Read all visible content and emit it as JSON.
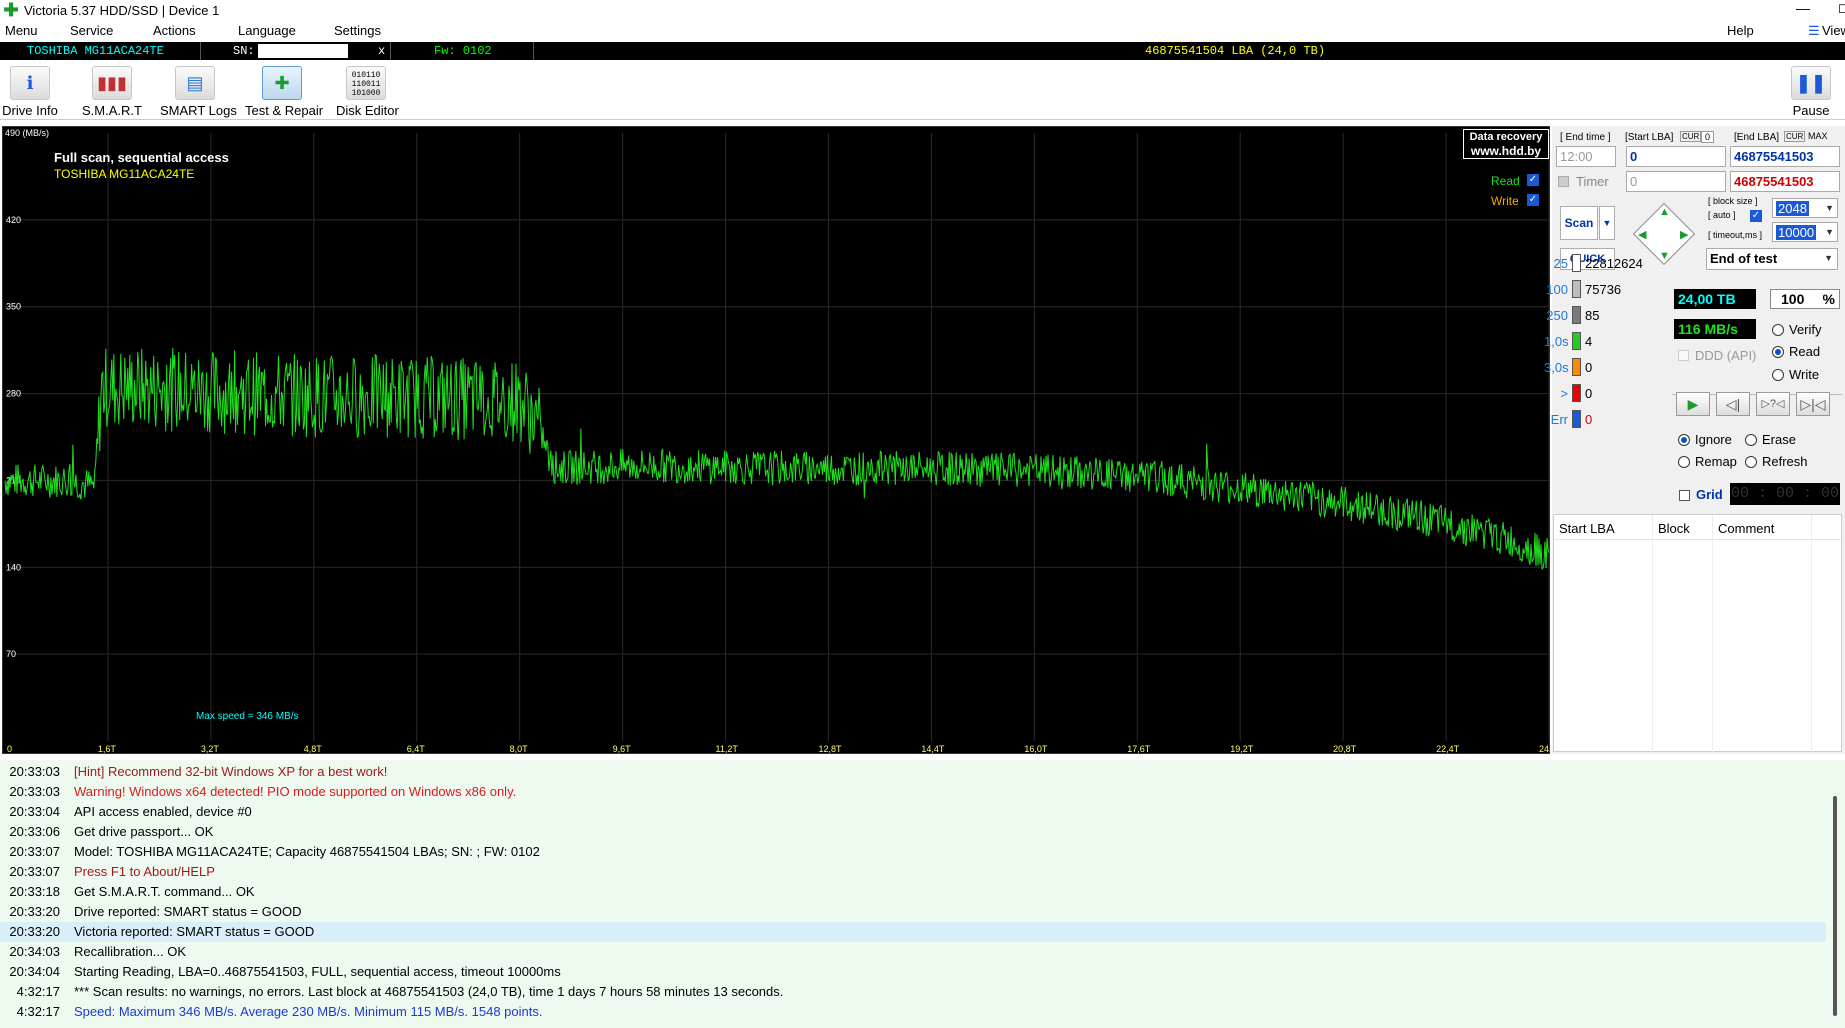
{
  "window": {
    "title": "Victoria 5.37 HDD/SSD | Device 1",
    "app_icon_color": "#1a9b2e"
  },
  "menu": {
    "items": [
      "Menu",
      "Service",
      "Actions",
      "Language",
      "Settings"
    ],
    "help": "Help",
    "view": "View"
  },
  "infobar": {
    "model": "TOSHIBA MG11ACA24TE",
    "sn_label": "SN:",
    "sn_close": "x",
    "fw": "Fw: 0102",
    "capacity": "46875541504 LBA (24,0 TB)"
  },
  "toolbar": {
    "buttons": [
      {
        "label": "Drive Info",
        "icon": "info-icon"
      },
      {
        "label": "S.M.A.R.T",
        "icon": "smart-chart-icon"
      },
      {
        "label": "SMART Logs",
        "icon": "logs-icon"
      },
      {
        "label": "Test & Repair",
        "icon": "plus-cross-icon"
      },
      {
        "label": "Disk Editor",
        "icon": "binary-icon"
      }
    ],
    "pause": "Pause"
  },
  "graph": {
    "title": "Full scan, sequential access",
    "device": "TOSHIBA MG11ACA24TE",
    "watermark1": "Data recovery",
    "watermark2": "www.hdd.by",
    "read_label": "Read",
    "write_label": "Write",
    "max_speed": "Max speed = 346 MB/s",
    "y_unit_label": "490 (MB/s)",
    "line_color": "#1fe01f"
  },
  "chart_data": {
    "type": "line",
    "title": "Full scan, sequential access",
    "xlabel": "",
    "ylabel": "(MB/s)",
    "x_ticks": [
      "0",
      "1,6T",
      "3,2T",
      "4,8T",
      "6,4T",
      "8,0T",
      "9,6T",
      "11,2T",
      "12,8T",
      "14,4T",
      "16,0T",
      "17,6T",
      "19,2T",
      "20,8T",
      "22,4T",
      "24,0T"
    ],
    "y_ticks": [
      "420",
      "350",
      "280",
      "210",
      "140",
      "70"
    ],
    "xlim": [
      0,
      24.0
    ],
    "ylim": [
      0,
      490
    ],
    "grid": true,
    "series": [
      {
        "name": "Read",
        "x": [
          0,
          1.0,
          1.4,
          1.5,
          2.0,
          3.0,
          4.0,
          5.0,
          6.0,
          7.0,
          8.0,
          8.3,
          8.5,
          10,
          12,
          14,
          16,
          17,
          18,
          19,
          20,
          21,
          22,
          23,
          24.0
        ],
        "y": [
          210,
          210,
          205,
          285,
          285,
          282,
          280,
          278,
          278,
          276,
          275,
          255,
          220,
          222,
          220,
          220,
          218,
          215,
          212,
          205,
          198,
          190,
          180,
          168,
          150
        ]
      }
    ]
  },
  "controls": {
    "end_time_label": "[ End time ]",
    "end_time": "12:00",
    "start_lba_label": "[Start LBA]",
    "cur_label": "CUR",
    "zero": "0",
    "end_lba_label": "[End LBA]",
    "max_label": "MAX",
    "start_lba": "0",
    "end_lba": "46875541503",
    "timer_label": "Timer",
    "timer_value": "0",
    "end_lba2": "46875541503",
    "scan": "Scan",
    "quick": "QUICK",
    "block_size_label": "[ block size ]",
    "auto_label": "[ auto ]",
    "timeout_label": "[ timeout,ms ]",
    "block_size": "2048",
    "timeout": "10000",
    "end_of_test": "End of test",
    "size_tb": "24,00 TB",
    "percent": "100",
    "pct_sign": "%",
    "speed": "116 MB/s",
    "ddd": "DDD (API)",
    "verify": "Verify",
    "read": "Read",
    "write": "Write",
    "ignore": "Ignore",
    "erase": "Erase",
    "remap": "Remap",
    "refresh": "Refresh",
    "grid": "Grid",
    "timer_display": "00 : 00 : 00"
  },
  "counters": [
    {
      "key": "25",
      "value": "22812624",
      "color": "#ffffff"
    },
    {
      "key": "100",
      "value": "75736",
      "color": "#bdbdbd"
    },
    {
      "key": "250",
      "value": "85",
      "color": "#7a7a7a"
    },
    {
      "key": "1,0s",
      "value": "4",
      "color": "#22cc22"
    },
    {
      "key": "3,0s",
      "value": "0",
      "color": "#ff8800"
    },
    {
      "key": ">",
      "value": "0",
      "color": "#ee0000"
    },
    {
      "key": "Err",
      "value": "0",
      "color": "#1a5ad8"
    }
  ],
  "table": {
    "headers": [
      "Start LBA",
      "Block",
      "Comment"
    ]
  },
  "log": [
    {
      "t": "20:33:03",
      "m": "[Hint] Recommend 32-bit Windows XP for a best work!",
      "c": "#9b1b1b"
    },
    {
      "t": "20:33:03",
      "m": "Warning! Windows x64 detected! PIO mode supported on Windows x86 only.",
      "c": "#d81b1b"
    },
    {
      "t": "20:33:04",
      "m": "API access enabled, device #0",
      "c": "#000000"
    },
    {
      "t": "20:33:06",
      "m": "Get drive passport... OK",
      "c": "#000000"
    },
    {
      "t": "20:33:07",
      "m": "Model: TOSHIBA MG11ACA24TE; Capacity 46875541504 LBAs; SN:                    ; FW: 0102",
      "c": "#000000"
    },
    {
      "t": "20:33:07",
      "m": "Press F1 to About/HELP",
      "c": "#9b1b1b"
    },
    {
      "t": "20:33:18",
      "m": "Get S.M.A.R.T. command... OK",
      "c": "#000000"
    },
    {
      "t": "20:33:20",
      "m": "Drive reported: SMART status = GOOD",
      "c": "#000000"
    },
    {
      "t": "20:33:20",
      "m": "Victoria reported: SMART status = GOOD",
      "c": "#000000"
    },
    {
      "t": "20:34:03",
      "m": "Recallibration... OK",
      "c": "#000000"
    },
    {
      "t": "20:34:04",
      "m": "Starting Reading, LBA=0..46875541503, FULL, sequential access, timeout 10000ms",
      "c": "#000000"
    },
    {
      "t": "4:32:17",
      "m": "*** Scan results: no warnings, no errors. Last block at 46875541503 (24,0 TB), time 1 days 7 hours 58 minutes 13 seconds.",
      "c": "#000000"
    },
    {
      "t": "4:32:17",
      "m": "Speed: Maximum 346 MB/s. Average 230 MB/s. Minimum 115 MB/s. 1548 points.",
      "c": "#1a3ad8"
    }
  ]
}
